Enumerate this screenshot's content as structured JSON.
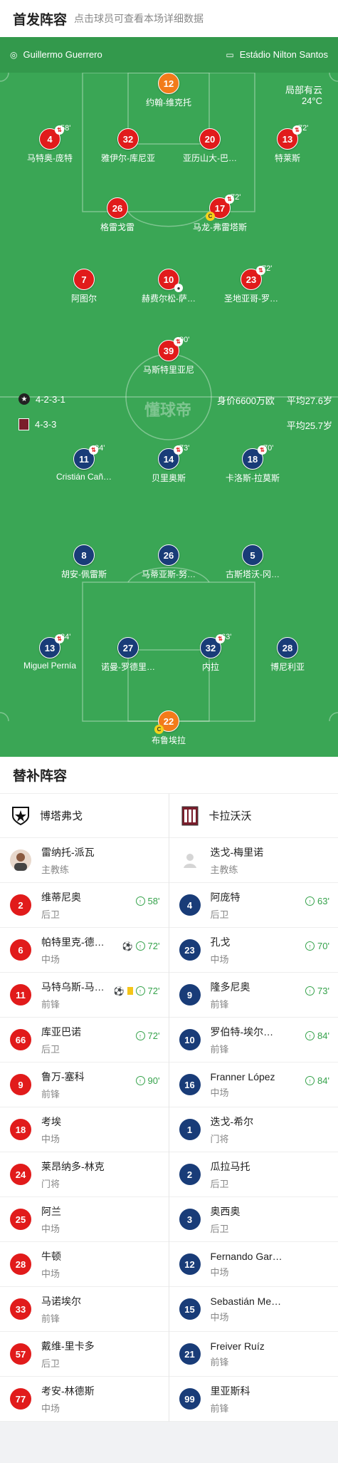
{
  "header": {
    "title": "首发阵容",
    "subtitle": "点击球员可查看本场详细数据"
  },
  "field": {
    "referee": "Guillermo Guerrero",
    "stadium": "Estádio Nilton Santos",
    "weather": "局部有云",
    "temperature": "24°C",
    "home_formation": "4-2-3-1",
    "away_formation": "4-3-3",
    "market_value": "身价6600万欧",
    "home_avg_age": "平均27.6岁",
    "away_avg_age": "平均25.7岁",
    "watermark": "懂球帝"
  },
  "home_players": [
    {
      "num": "12",
      "name": "约翰-维克托",
      "sub": ""
    },
    {
      "num": "4",
      "name": "马特奥-庞特",
      "sub": "58'"
    },
    {
      "num": "32",
      "name": "雅伊尔-库尼亚",
      "sub": ""
    },
    {
      "num": "20",
      "name": "亚历山大-巴…",
      "sub": ""
    },
    {
      "num": "13",
      "name": "特莱斯",
      "sub": "72'"
    },
    {
      "num": "26",
      "name": "格雷戈雷",
      "sub": ""
    },
    {
      "num": "17",
      "name": "马龙-弗雷塔斯",
      "sub": "72'"
    },
    {
      "num": "7",
      "name": "阿图尔",
      "sub": ""
    },
    {
      "num": "10",
      "name": "赫费尔松-萨…",
      "sub": ""
    },
    {
      "num": "23",
      "name": "圣地亚哥-罗…",
      "sub": "72'"
    },
    {
      "num": "39",
      "name": "马斯特里亚尼",
      "sub": "90'"
    }
  ],
  "away_players": [
    {
      "num": "11",
      "name": "Cristián Cañ…",
      "sub": "84'"
    },
    {
      "num": "14",
      "name": "贝里奥斯",
      "sub": "73'"
    },
    {
      "num": "18",
      "name": "卡洛斯-拉莫斯",
      "sub": "70'"
    },
    {
      "num": "8",
      "name": "胡安-佩雷斯",
      "sub": ""
    },
    {
      "num": "26",
      "name": "马蒂亚斯-努…",
      "sub": ""
    },
    {
      "num": "5",
      "name": "古斯塔沃-冈…",
      "sub": ""
    },
    {
      "num": "13",
      "name": "Miguel Pernía",
      "sub": "84'"
    },
    {
      "num": "27",
      "name": "诺曼-罗德里…",
      "sub": ""
    },
    {
      "num": "32",
      "name": "内拉",
      "sub": "63'"
    },
    {
      "num": "28",
      "name": "博尼利亚",
      "sub": ""
    },
    {
      "num": "22",
      "name": "布鲁埃拉",
      "sub": ""
    }
  ],
  "subs": {
    "title": "替补阵容",
    "home_team": "博塔弗戈",
    "away_team": "卡拉沃沃",
    "home_coach": {
      "name": "雷纳托-派瓦",
      "role": "主教练"
    },
    "away_coach": {
      "name": "迭戈-梅里诺",
      "role": "主教练"
    },
    "home": [
      {
        "num": "2",
        "name": "维蒂尼奥",
        "pos": "后卫",
        "time": "58'"
      },
      {
        "num": "6",
        "name": "帕特里克-德…",
        "pos": "中场",
        "time": "72'"
      },
      {
        "num": "11",
        "name": "马特乌斯-马…",
        "pos": "前锋",
        "time": "72'"
      },
      {
        "num": "66",
        "name": "库亚巴诺",
        "pos": "后卫",
        "time": "72'"
      },
      {
        "num": "9",
        "name": "鲁万-塞科",
        "pos": "前锋",
        "time": "90'"
      },
      {
        "num": "18",
        "name": "考埃",
        "pos": "中场",
        "time": ""
      },
      {
        "num": "24",
        "name": "莱昂纳多-林克",
        "pos": "门将",
        "time": ""
      },
      {
        "num": "25",
        "name": "阿兰",
        "pos": "中场",
        "time": ""
      },
      {
        "num": "28",
        "name": "牛顿",
        "pos": "中场",
        "time": ""
      },
      {
        "num": "33",
        "name": "马诺埃尔",
        "pos": "前锋",
        "time": ""
      },
      {
        "num": "57",
        "name": "戴维-里卡多",
        "pos": "后卫",
        "time": ""
      },
      {
        "num": "77",
        "name": "考安-林德斯",
        "pos": "中场",
        "time": ""
      }
    ],
    "away": [
      {
        "num": "4",
        "name": "阿庞特",
        "pos": "后卫",
        "time": "63'"
      },
      {
        "num": "23",
        "name": "孔戈",
        "pos": "中场",
        "time": "70'"
      },
      {
        "num": "9",
        "name": "隆多尼奥",
        "pos": "前锋",
        "time": "73'"
      },
      {
        "num": "10",
        "name": "罗伯特-埃尔…",
        "pos": "前锋",
        "time": "84'"
      },
      {
        "num": "16",
        "name": "Franner López",
        "pos": "中场",
        "time": "84'"
      },
      {
        "num": "1",
        "name": "迭戈-希尔",
        "pos": "门将",
        "time": ""
      },
      {
        "num": "2",
        "name": "瓜拉马托",
        "pos": "后卫",
        "time": ""
      },
      {
        "num": "3",
        "name": "奥西奥",
        "pos": "后卫",
        "time": ""
      },
      {
        "num": "12",
        "name": "Fernando Gar…",
        "pos": "中场",
        "time": ""
      },
      {
        "num": "15",
        "name": "Sebastián Me…",
        "pos": "中场",
        "time": ""
      },
      {
        "num": "21",
        "name": "Freiver Ruíz",
        "pos": "前锋",
        "time": ""
      },
      {
        "num": "99",
        "name": "里亚斯科",
        "pos": "前锋",
        "time": ""
      }
    ]
  }
}
